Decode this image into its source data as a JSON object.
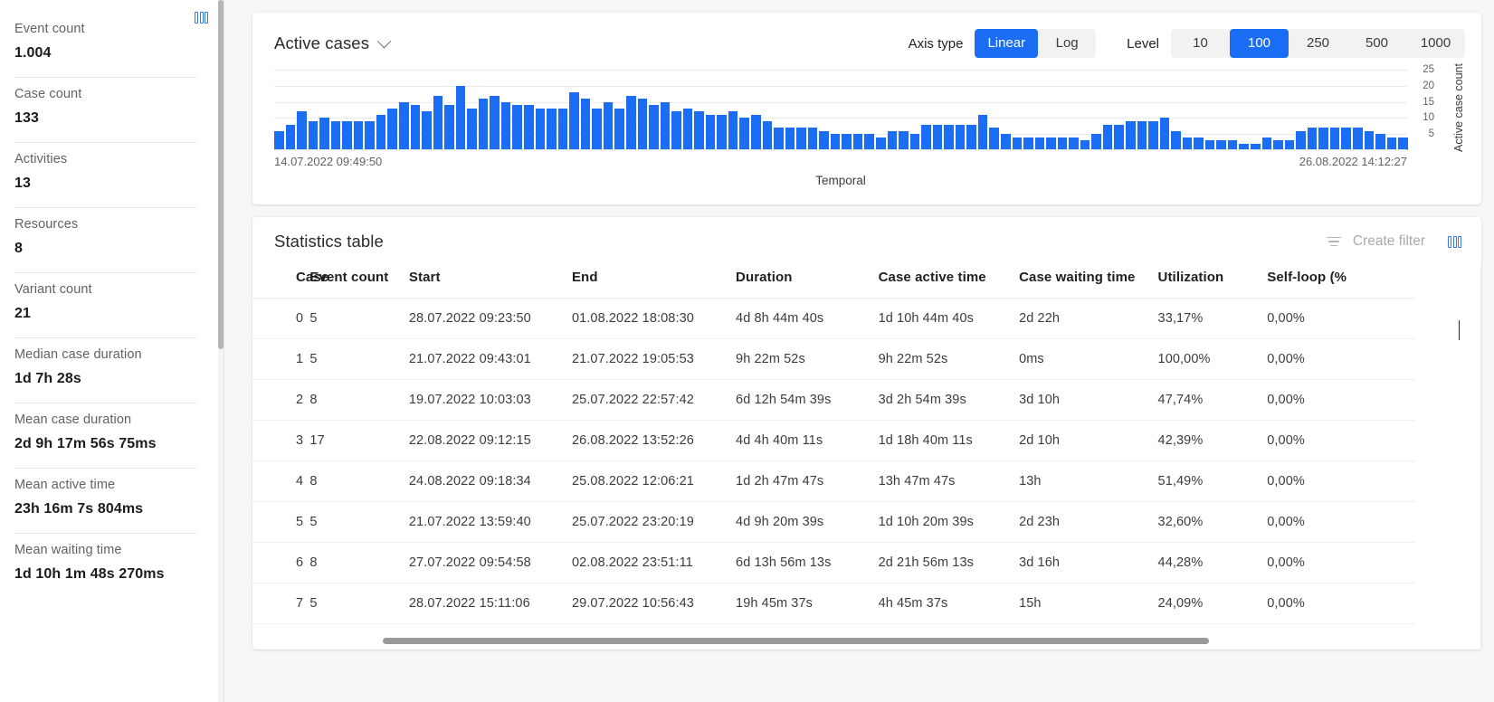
{
  "sidebar": {
    "stats": [
      {
        "label": "Event count",
        "value": "1.004"
      },
      {
        "label": "Case count",
        "value": "133"
      },
      {
        "label": "Activities",
        "value": "13"
      },
      {
        "label": "Resources",
        "value": "8"
      },
      {
        "label": "Variant count",
        "value": "21"
      },
      {
        "label": "Median case duration",
        "value": "1d 7h 28s"
      },
      {
        "label": "Mean case duration",
        "value": "2d 9h 17m 56s 75ms"
      },
      {
        "label": "Mean active time",
        "value": "23h 16m 7s 804ms"
      },
      {
        "label": "Mean waiting time",
        "value": "1d 10h 1m 48s 270ms"
      }
    ],
    "columns_icon": "columns-icon"
  },
  "chart_panel": {
    "title": "Active cases",
    "dropdown_icon": "chevron-down-icon",
    "axis_type_label": "Axis type",
    "axis_type_options": [
      "Linear",
      "Log"
    ],
    "axis_type_selected": "Linear",
    "level_label": "Level",
    "level_options": [
      "10",
      "100",
      "250",
      "500",
      "1000"
    ],
    "level_selected": "100"
  },
  "chart_data": {
    "type": "bar",
    "title": "Active cases",
    "xlabel": "Temporal",
    "ylabel": "Active case count",
    "x_start_label": "14.07.2022 09:49:50",
    "x_end_label": "26.08.2022 14:12:27",
    "yticks": [
      5,
      10,
      15,
      20,
      25
    ],
    "ylim": [
      0,
      27
    ],
    "grid": true,
    "legend": "none",
    "values": [
      6,
      8,
      12,
      9,
      10,
      9,
      9,
      9,
      9,
      11,
      13,
      15,
      14,
      12,
      17,
      14,
      20,
      13,
      16,
      17,
      15,
      14,
      14,
      13,
      13,
      13,
      18,
      16,
      13,
      15,
      13,
      17,
      16,
      14,
      15,
      12,
      13,
      12,
      11,
      11,
      12,
      10,
      11,
      9,
      7,
      7,
      7,
      7,
      6,
      5,
      5,
      5,
      5,
      4,
      6,
      6,
      5,
      8,
      8,
      8,
      8,
      8,
      11,
      7,
      5,
      4,
      4,
      4,
      4,
      4,
      4,
      3,
      5,
      8,
      8,
      9,
      9,
      9,
      10,
      6,
      4,
      4,
      3,
      3,
      3,
      2,
      2,
      4,
      3,
      3,
      6,
      7,
      7,
      7,
      7,
      7,
      6,
      5,
      4,
      4
    ]
  },
  "table_panel": {
    "title": "Statistics table",
    "filter_icon": "filter-icon",
    "create_filter_label": "Create filter",
    "columns_icon": "columns-icon",
    "columns": [
      "Case",
      "Event count",
      "Start",
      "End",
      "Duration",
      "Case active time",
      "Case waiting time",
      "Utilization",
      "Self-loop (%"
    ],
    "rows": [
      {
        "case": "0",
        "event_count": "5",
        "start": "28.07.2022 09:23:50",
        "end": "01.08.2022 18:08:30",
        "duration": "4d 8h 44m 40s",
        "active": "1d 10h 44m 40s",
        "waiting": "2d 22h",
        "utilization": "33,17%",
        "self_loop": "0,00%"
      },
      {
        "case": "1",
        "event_count": "5",
        "start": "21.07.2022 09:43:01",
        "end": "21.07.2022 19:05:53",
        "duration": "9h 22m 52s",
        "active": "9h 22m 52s",
        "waiting": "0ms",
        "utilization": "100,00%",
        "self_loop": "0,00%"
      },
      {
        "case": "2",
        "event_count": "8",
        "start": "19.07.2022 10:03:03",
        "end": "25.07.2022 22:57:42",
        "duration": "6d 12h 54m 39s",
        "active": "3d 2h 54m 39s",
        "waiting": "3d 10h",
        "utilization": "47,74%",
        "self_loop": "0,00%"
      },
      {
        "case": "3",
        "event_count": "17",
        "start": "22.08.2022 09:12:15",
        "end": "26.08.2022 13:52:26",
        "duration": "4d 4h 40m 11s",
        "active": "1d 18h 40m 11s",
        "waiting": "2d 10h",
        "utilization": "42,39%",
        "self_loop": "0,00%"
      },
      {
        "case": "4",
        "event_count": "8",
        "start": "24.08.2022 09:18:34",
        "end": "25.08.2022 12:06:21",
        "duration": "1d 2h 47m 47s",
        "active": "13h 47m 47s",
        "waiting": "13h",
        "utilization": "51,49%",
        "self_loop": "0,00%"
      },
      {
        "case": "5",
        "event_count": "5",
        "start": "21.07.2022 13:59:40",
        "end": "25.07.2022 23:20:19",
        "duration": "4d 9h 20m 39s",
        "active": "1d 10h 20m 39s",
        "waiting": "2d 23h",
        "utilization": "32,60%",
        "self_loop": "0,00%"
      },
      {
        "case": "6",
        "event_count": "8",
        "start": "27.07.2022 09:54:58",
        "end": "02.08.2022 23:51:11",
        "duration": "6d 13h 56m 13s",
        "active": "2d 21h 56m 13s",
        "waiting": "3d 16h",
        "utilization": "44,28%",
        "self_loop": "0,00%"
      },
      {
        "case": "7",
        "event_count": "5",
        "start": "28.07.2022 15:11:06",
        "end": "29.07.2022 10:56:43",
        "duration": "19h 45m 37s",
        "active": "4h 45m 37s",
        "waiting": "15h",
        "utilization": "24,09%",
        "self_loop": "0,00%"
      }
    ]
  },
  "colors": {
    "accent": "#1b6ef3",
    "bar": "#1b6ef3",
    "panel_bg": "#f7f7f7",
    "card_bg": "#ffffff",
    "muted_text": "#5f6368"
  }
}
